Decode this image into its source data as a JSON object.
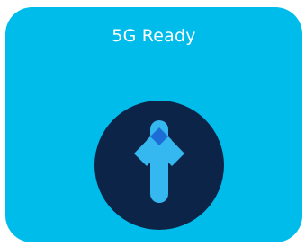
{
  "card": {
    "title": "5G Ready"
  },
  "icon": {
    "name": "upload-arrow-icon"
  },
  "colors": {
    "card_background": "#00bceb",
    "badge_background": "#0b2448",
    "arrow_light": "#35b7ef",
    "arrow_dark": "#1d6dd7",
    "title_text": "#ffffff"
  }
}
